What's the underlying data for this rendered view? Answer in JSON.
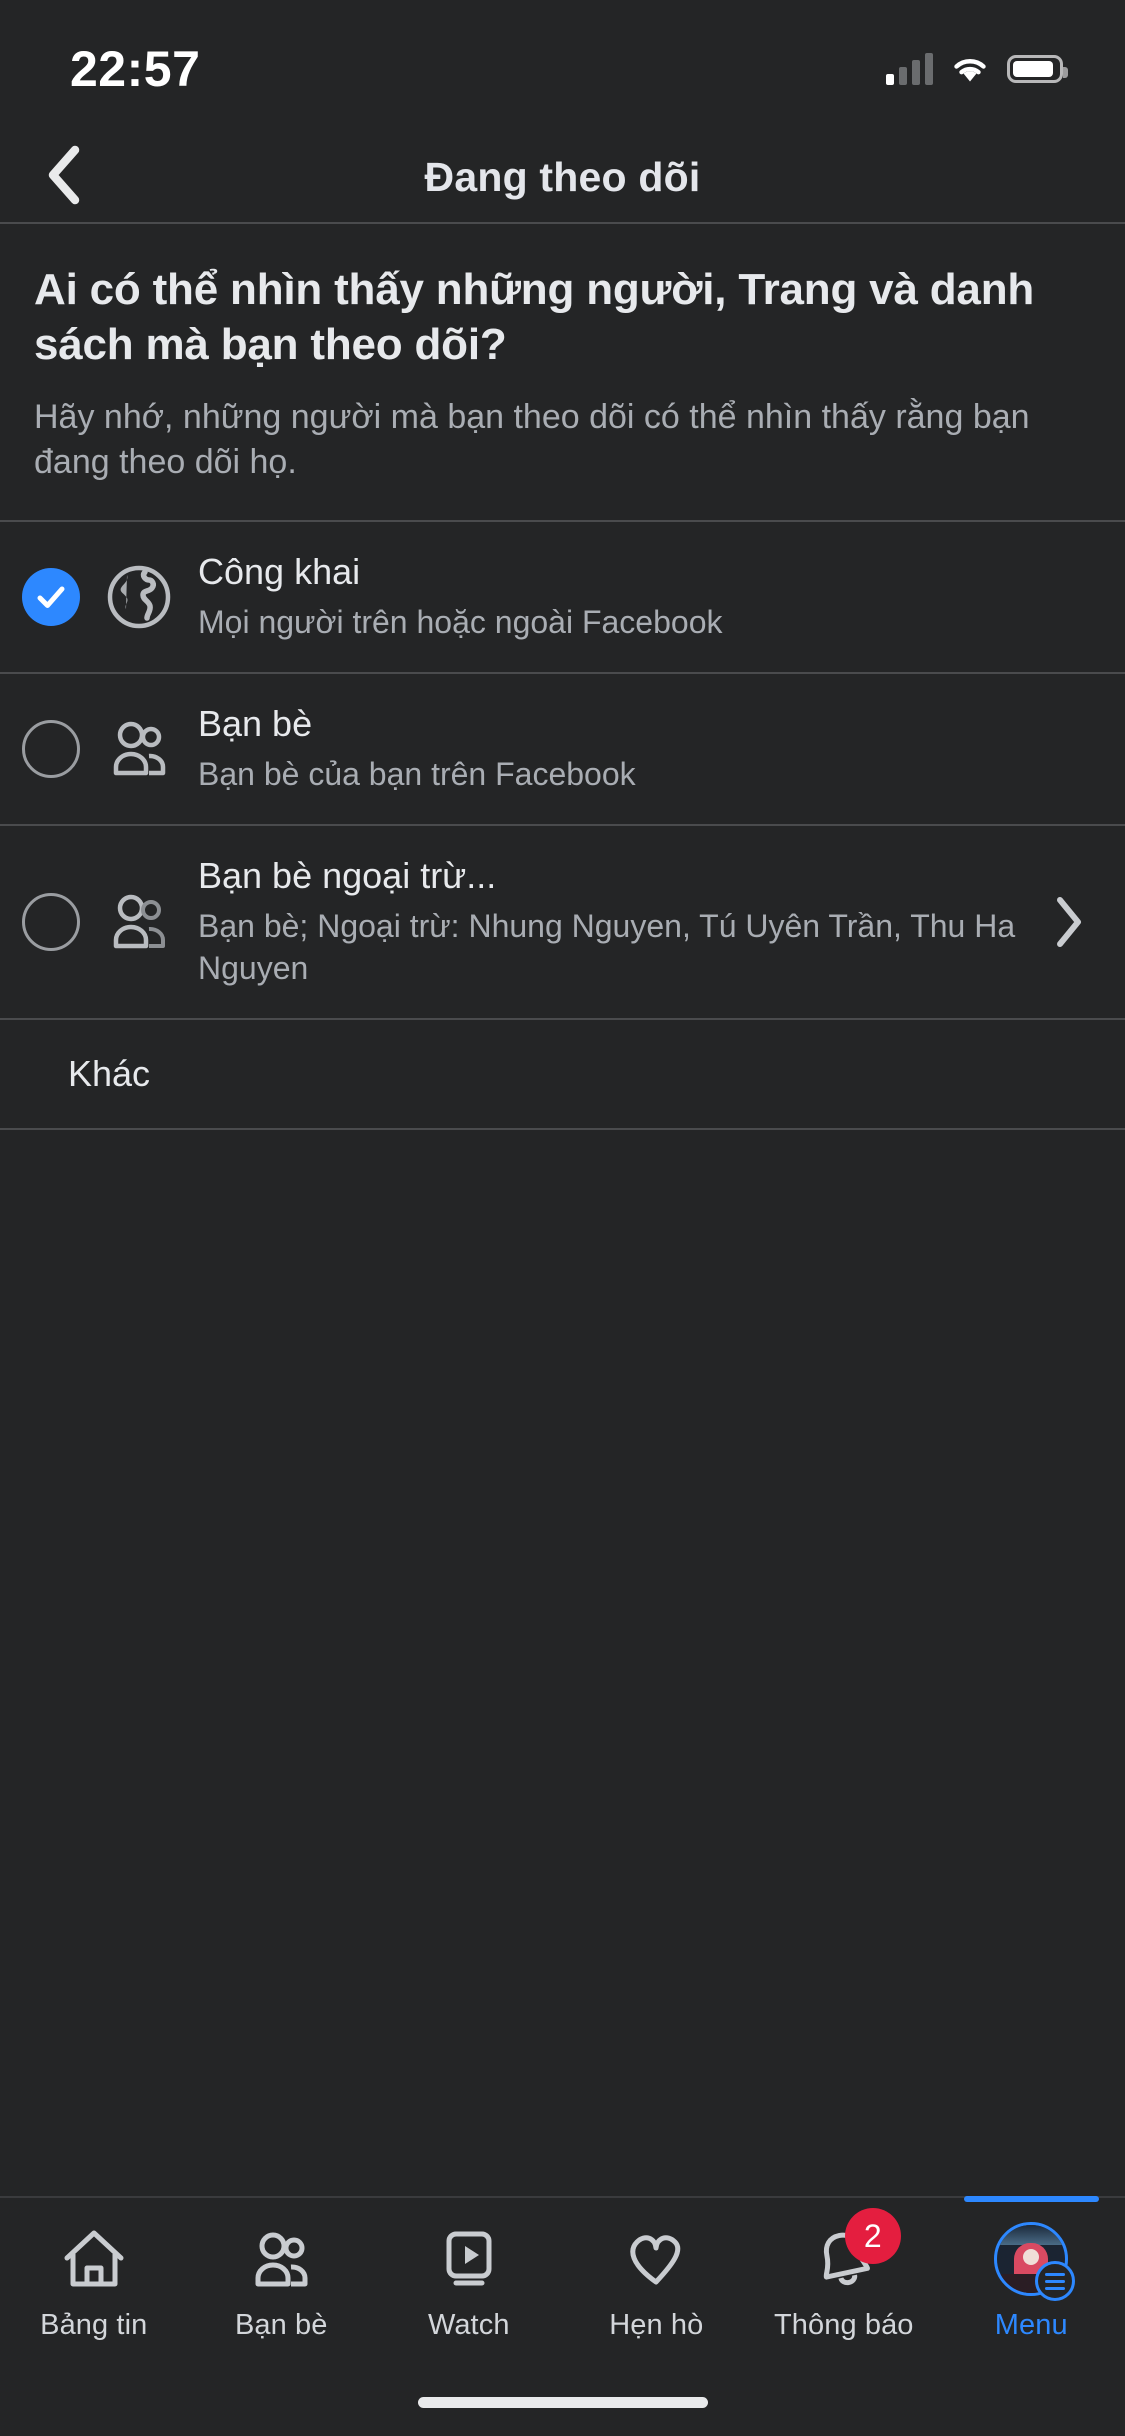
{
  "status_bar": {
    "time": "22:57",
    "signal_icon": "cellular-signal-icon",
    "wifi_icon": "wifi-icon",
    "battery_icon": "battery-icon",
    "signal_bars_filled": 1,
    "signal_bars_total": 4
  },
  "header": {
    "back_icon": "chevron-left-icon",
    "title": "Đang theo dõi"
  },
  "intro": {
    "heading": "Ai có thể nhìn thấy những người, Trang và danh sách mà bạn theo dõi?",
    "description": "Hãy nhớ, những người mà bạn theo dõi có thể nhìn thấy rằng bạn đang theo dõi họ."
  },
  "options": [
    {
      "id": "public",
      "title": "Công khai",
      "subtitle": "Mọi người trên hoặc ngoài Facebook",
      "icon": "globe-icon",
      "selected": true,
      "has_chevron": false
    },
    {
      "id": "friends",
      "title": "Bạn bè",
      "subtitle": "Bạn bè của bạn trên Facebook",
      "icon": "friends-icon",
      "selected": false,
      "has_chevron": false
    },
    {
      "id": "friends-except",
      "title": "Bạn bè ngoại trừ...",
      "subtitle": "Bạn bè; Ngoại trừ: Nhung Nguyen, Tú Uyên Trần, Thu Ha Nguyen",
      "icon": "friends-except-icon",
      "selected": false,
      "has_chevron": true,
      "chevron_icon": "chevron-right-icon"
    }
  ],
  "other_row": {
    "label": "Khác"
  },
  "tabbar": {
    "items": [
      {
        "label": "Bảng tin",
        "icon": "home-icon",
        "active": false,
        "badge": null
      },
      {
        "label": "Bạn bè",
        "icon": "friends-icon",
        "active": false,
        "badge": null
      },
      {
        "label": "Watch",
        "icon": "watch-play-icon",
        "active": false,
        "badge": null
      },
      {
        "label": "Hẹn hò",
        "icon": "dating-heart-icon",
        "active": false,
        "badge": null
      },
      {
        "label": "Thông báo",
        "icon": "bell-icon",
        "active": false,
        "badge": "2"
      },
      {
        "label": "Menu",
        "icon": "profile-menu-avatar-icon",
        "active": true,
        "badge": null
      }
    ]
  },
  "colors": {
    "background": "#242526",
    "accent_blue": "#2d88ff",
    "badge_red": "#e41e3f",
    "primary_text": "#e7e9ec",
    "secondary_text": "#a9adb3",
    "divider": "#4a4b4d"
  }
}
